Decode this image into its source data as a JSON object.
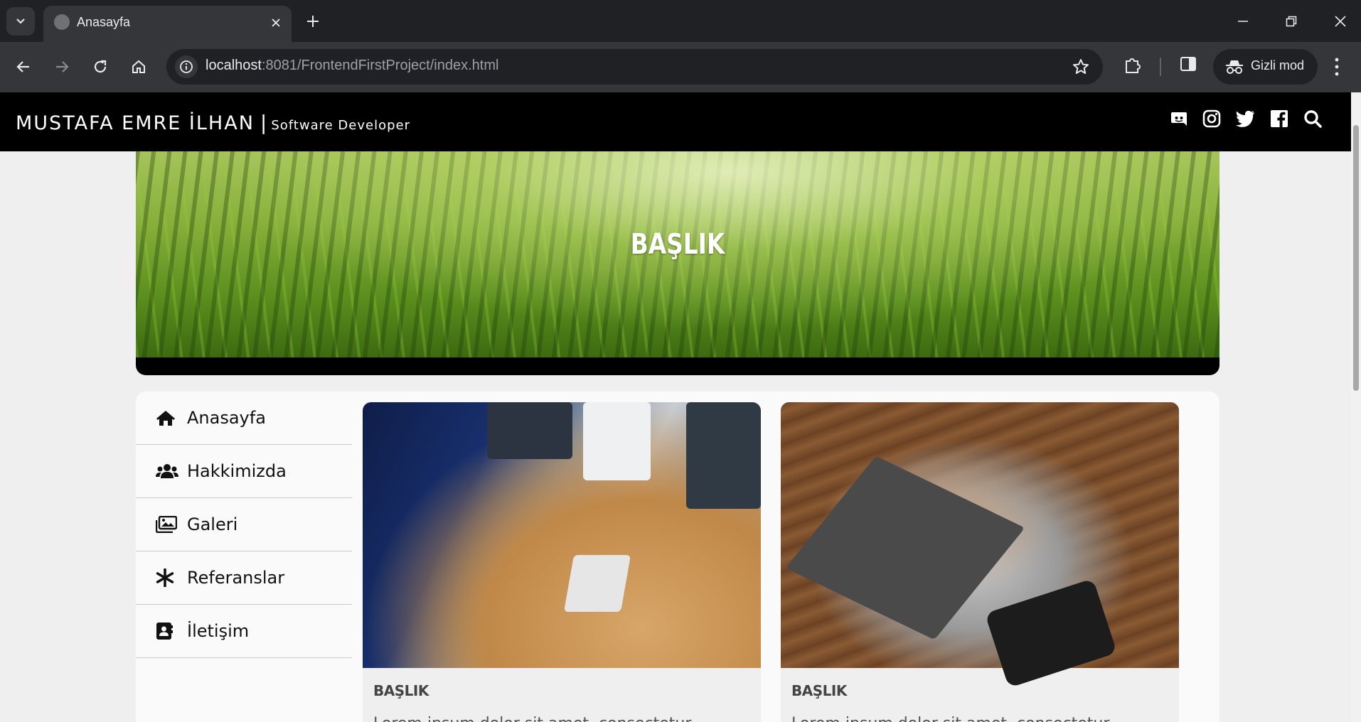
{
  "browser": {
    "tab_title": "Anasayfa",
    "url_host": "localhost",
    "url_rest": ":8081/FrontendFirstProject/index.html",
    "incognito_label": "Gizli mod"
  },
  "site": {
    "brand_name": "MUSTAFA EMRE İLHAN",
    "brand_separator": "|",
    "brand_subtitle": "Software Developer",
    "social_icons": [
      "discord-icon",
      "instagram-icon",
      "twitter-icon",
      "facebook-icon",
      "search-icon"
    ]
  },
  "banner": {
    "title": "BAŞLIK"
  },
  "menu": {
    "items": [
      {
        "label": "Anasayfa",
        "icon": "home-icon"
      },
      {
        "label": "Hakkimizda",
        "icon": "users-icon"
      },
      {
        "label": "Galeri",
        "icon": "images-icon"
      },
      {
        "label": "Referanslar",
        "icon": "asterisk-icon"
      },
      {
        "label": "İletişim",
        "icon": "contact-card-icon"
      }
    ]
  },
  "cards": [
    {
      "title": "BAŞLIK",
      "text": "Lorem ipsum dolor sit amet, consectetur"
    },
    {
      "title": "BAŞLIK",
      "text": "Lorem ipsum dolor sit amet, consectetur"
    }
  ]
}
